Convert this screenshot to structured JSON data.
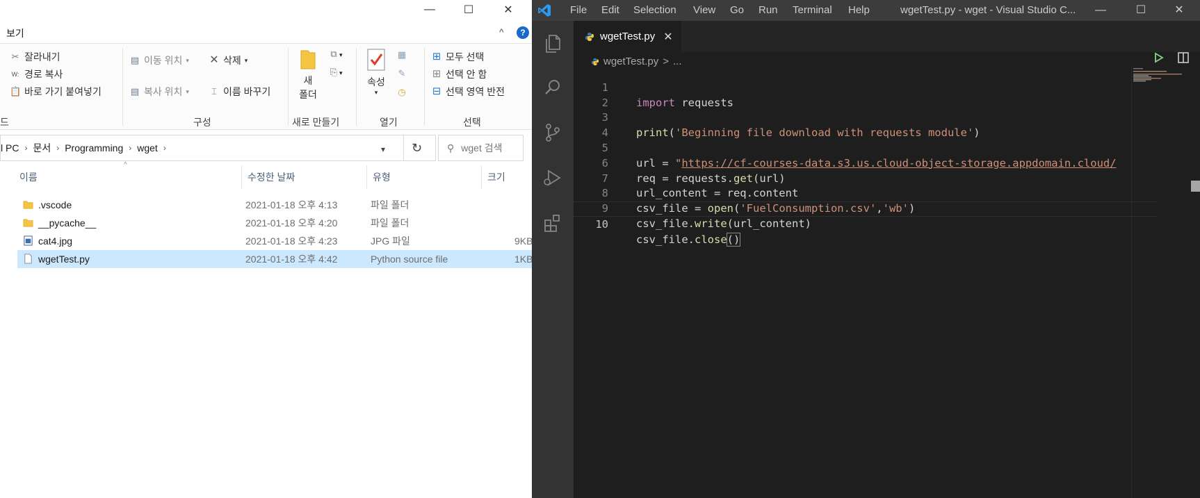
{
  "explorer": {
    "window_controls": {
      "minimize": "—",
      "maximize": "☐",
      "close": "✕"
    },
    "tab": "보기",
    "collapse": "^",
    "help": "?",
    "ribbon": {
      "clipboard": {
        "cut": "잘라내기",
        "copy_path": "경로 복사",
        "paste_shortcut": "바로 가기 붙여넣기",
        "group_label": "드"
      },
      "organize": {
        "move_to": "이동 위치",
        "copy_to": "복사 위치",
        "delete": "삭제",
        "rename": "이름 바꾸기",
        "group_label": "구성"
      },
      "new": {
        "new_folder_line1": "새",
        "new_folder_line2": "폴더",
        "group_label": "새로 만들기"
      },
      "open": {
        "properties": "속성",
        "group_label": "열기"
      },
      "select": {
        "select_all": "모두 선택",
        "select_none": "선택 안 함",
        "invert": "선택 영역 반전",
        "group_label": "선택"
      }
    },
    "address": {
      "crumbs": [
        "l PC",
        "문서",
        "Programming",
        "wget"
      ]
    },
    "search": {
      "placeholder": "wget 검색"
    },
    "columns": {
      "name": "이름",
      "modified": "수정한 날짜",
      "type": "유형",
      "size": "크기"
    },
    "files": [
      {
        "name": ".vscode",
        "modified": "2021-01-18 오후 4:13",
        "type": "파일 폴더",
        "size": ""
      },
      {
        "name": "__pycache__",
        "modified": "2021-01-18 오후 4:20",
        "type": "파일 폴더",
        "size": ""
      },
      {
        "name": "cat4.jpg",
        "modified": "2021-01-18 오후 4:23",
        "type": "JPG 파일",
        "size": "9KB"
      },
      {
        "name": "wgetTest.py",
        "modified": "2021-01-18 오후 4:42",
        "type": "Python source file",
        "size": "1KB"
      }
    ]
  },
  "vscode": {
    "menu": [
      "File",
      "Edit",
      "Selection",
      "View",
      "Go",
      "Run",
      "Terminal",
      "Help"
    ],
    "title": "wgetTest.py - wget - Visual Studio C...",
    "window_controls": {
      "minimize": "—",
      "maximize": "☐",
      "close": "✕"
    },
    "tab": {
      "label": "wgetTest.py",
      "close": "✕"
    },
    "breadcrumb": {
      "file": "wgetTest.py",
      "sep": ">",
      "rest": "..."
    },
    "line_numbers": [
      "1",
      "2",
      "3",
      "4",
      "5",
      "6",
      "7",
      "8",
      "9",
      "10"
    ],
    "code": {
      "l1_kw": "import",
      "l1_rest": " requests",
      "l3_fn": "print",
      "l3_open": "(",
      "l3_str": "'Beginning file download with requests module'",
      "l3_close": ")",
      "l5_pre": "url = ",
      "l5_q": "\"",
      "l5_url": "https://cf-courses-data.s3.us.cloud-object-storage.appdomain.cloud/",
      "l6_pre": "req = requests.",
      "l6_fn": "get",
      "l6_rest": "(url)",
      "l7": "url_content = req.content",
      "l8_pre": "csv_file = ",
      "l8_fn": "open",
      "l8_open": "(",
      "l8_s1": "'FuelConsumption.csv'",
      "l8_comma": ",",
      "l8_s2": "'wb'",
      "l8_close": ")",
      "l9_pre": "csv_file.",
      "l9_fn": "write",
      "l9_rest": "(url_content)",
      "l10_pre": "csv_file.",
      "l10_fn": "close",
      "l10_br": "()"
    }
  },
  "colors": {
    "vs_bg": "#1e1e1e",
    "vs_title": "#3c3c3c",
    "selection": "#cce8ff",
    "accent": "#007acc"
  }
}
